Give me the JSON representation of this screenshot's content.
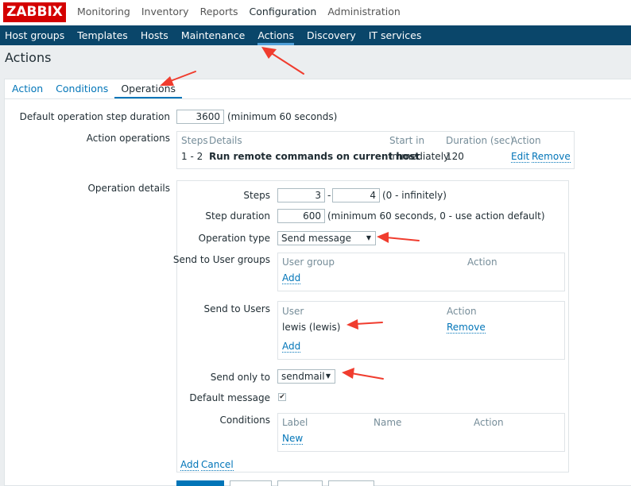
{
  "header": {
    "logo": "ZABBIX",
    "menu": [
      "Monitoring",
      "Inventory",
      "Reports",
      "Configuration",
      "Administration"
    ]
  },
  "subnav": [
    "Host groups",
    "Templates",
    "Hosts",
    "Maintenance",
    "Actions",
    "Discovery",
    "IT services"
  ],
  "page_title": "Actions",
  "tabs": [
    "Action",
    "Conditions",
    "Operations"
  ],
  "step_duration": {
    "label": "Default operation step duration",
    "value": "3600",
    "hint": "(minimum 60 seconds)"
  },
  "action_operations": {
    "label": "Action operations",
    "headers": [
      "Steps",
      "Details",
      "Start in",
      "Duration (sec)",
      "Action"
    ],
    "rows": [
      {
        "steps": "1 - 2",
        "details": "Run remote commands on current host",
        "start_in": "Immediately",
        "duration": "120",
        "edit": "Edit",
        "remove": "Remove"
      }
    ]
  },
  "operation_details": {
    "label": "Operation details",
    "steps": {
      "label": "Steps",
      "from": "3",
      "sep": "-",
      "to": "4",
      "hint": "(0 - infinitely)"
    },
    "step_duration": {
      "label": "Step duration",
      "value": "600",
      "hint": "(minimum 60 seconds, 0 - use action default)"
    },
    "operation_type": {
      "label": "Operation type",
      "value": "Send message"
    },
    "user_groups": {
      "label": "Send to User groups",
      "col1": "User group",
      "col2": "Action",
      "add": "Add"
    },
    "users": {
      "label": "Send to Users",
      "col1": "User",
      "col2": "Action",
      "rows": [
        {
          "name": "lewis (lewis)",
          "remove": "Remove"
        }
      ],
      "add": "Add"
    },
    "send_only_to": {
      "label": "Send only to",
      "value": "sendmail"
    },
    "default_message": {
      "label": "Default message",
      "checked": true,
      "mark": "✔"
    },
    "conditions": {
      "label": "Conditions",
      "col1": "Label",
      "col2": "Name",
      "col3": "Action",
      "new": "New"
    },
    "add": "Add",
    "cancel": "Cancel"
  },
  "colors": {
    "brand": "#d40000",
    "nav": "#0a466a",
    "link": "#0275b8",
    "annotation": "#f03c2e"
  }
}
